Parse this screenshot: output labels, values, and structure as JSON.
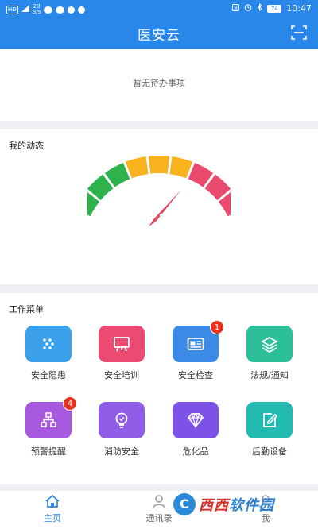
{
  "status_bar": {
    "hd_label": "HD",
    "net_speed": "20\nB/s",
    "battery": "74",
    "time": "10:47"
  },
  "header": {
    "title": "医安云",
    "scan_icon": "scan-icon"
  },
  "todo": {
    "empty_text": "暂无待办事项"
  },
  "dynamics": {
    "title": "我的动态",
    "gauge_colors": [
      "#2db24c",
      "#f7b21d",
      "#e94a6d"
    ],
    "needle_color": "#e0485f"
  },
  "menu": {
    "title": "工作菜单",
    "items": [
      {
        "label": "安全隐患",
        "icon": "dots-icon",
        "color": "#3aa0ea",
        "badge": ""
      },
      {
        "label": "安全培训",
        "icon": "board-icon",
        "color": "#ec4a71",
        "badge": ""
      },
      {
        "label": "安全检查",
        "icon": "id-card-icon",
        "color": "#3a8ae6",
        "badge": "1"
      },
      {
        "label": "法规/通知",
        "icon": "layers-icon",
        "color": "#2cbf9a",
        "badge": ""
      },
      {
        "label": "预警提醒",
        "icon": "org-chart-icon",
        "color": "#a759e0",
        "badge": "4"
      },
      {
        "label": "消防安全",
        "icon": "bulb-icon",
        "color": "#8f5de8",
        "badge": ""
      },
      {
        "label": "危化品",
        "icon": "diamond-icon",
        "color": "#7d52e6",
        "badge": ""
      },
      {
        "label": "后勤设备",
        "icon": "edit-doc-icon",
        "color": "#21b9b0",
        "badge": ""
      }
    ]
  },
  "bottom_nav": {
    "items": [
      {
        "label": "主页",
        "icon": "home-icon",
        "active": true
      },
      {
        "label": "通讯录",
        "icon": "contacts-icon",
        "active": false
      },
      {
        "label": "我",
        "icon": "user-icon",
        "active": false
      }
    ]
  },
  "watermark": {
    "mark": "C",
    "text_red": "西西",
    "text_blue": "软件园"
  },
  "colors": {
    "primary": "#2a87ea",
    "background": "#eef0f3",
    "badge": "#e8321e"
  }
}
